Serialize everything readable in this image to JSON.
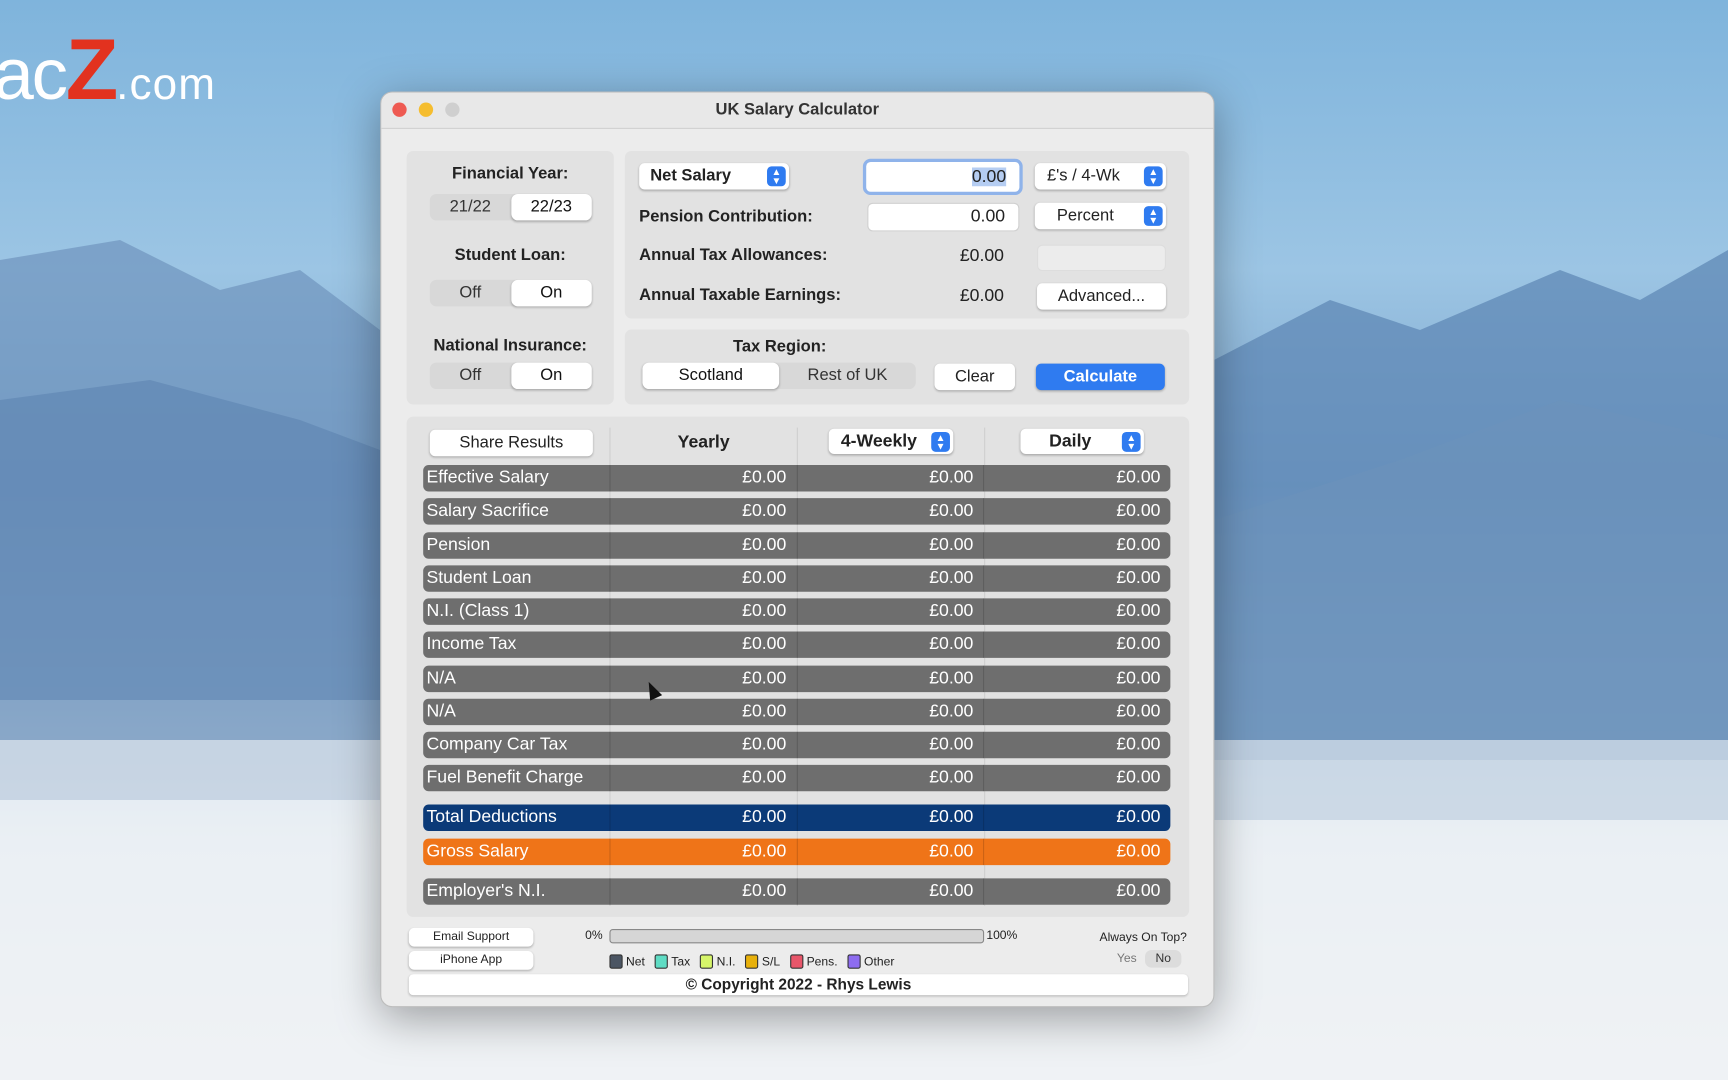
{
  "watermark": "macZ.com",
  "window": {
    "title": "UK Salary Calculator"
  },
  "left": {
    "financial_year_label": "Financial Year:",
    "years": [
      "21/22",
      "22/23"
    ],
    "year_selected": "22/23",
    "student_loan_label": "Student Loan:",
    "student_loan_options": [
      "Off",
      "On"
    ],
    "student_loan_selected": "On",
    "ni_label": "National Insurance:",
    "ni_options": [
      "Off",
      "On"
    ],
    "ni_selected": "On"
  },
  "inputs": {
    "salary_type": "Net Salary",
    "salary_value": "0.00",
    "salary_period": "£'s / 4-Wk",
    "pension_label": "Pension Contribution:",
    "pension_value": "0.00",
    "pension_unit": "Percent",
    "allowances_label": "Annual Tax Allowances:",
    "allowances_value": "£0.00",
    "taxable_label": "Annual Taxable Earnings:",
    "taxable_value": "£0.00",
    "advanced_label": "Advanced..."
  },
  "tax_region": {
    "label": "Tax Region:",
    "options": [
      "Scotland",
      "Rest of UK"
    ],
    "selected": "Scotland",
    "clear_label": "Clear",
    "calculate_label": "Calculate"
  },
  "results": {
    "share_label": "Share Results",
    "columns": [
      "Yearly",
      "4-Weekly",
      "Daily"
    ],
    "rows": [
      {
        "label": "Effective Salary",
        "values": [
          "£0.00",
          "£0.00",
          "£0.00"
        ]
      },
      {
        "label": "Salary Sacrifice",
        "values": [
          "£0.00",
          "£0.00",
          "£0.00"
        ]
      },
      {
        "label": "Pension",
        "values": [
          "£0.00",
          "£0.00",
          "£0.00"
        ]
      },
      {
        "label": "Student Loan",
        "values": [
          "£0.00",
          "£0.00",
          "£0.00"
        ]
      },
      {
        "label": "N.I. (Class 1)",
        "values": [
          "£0.00",
          "£0.00",
          "£0.00"
        ]
      },
      {
        "label": "Income Tax",
        "values": [
          "£0.00",
          "£0.00",
          "£0.00"
        ]
      },
      {
        "label": "N/A",
        "values": [
          "£0.00",
          "£0.00",
          "£0.00"
        ]
      },
      {
        "label": "N/A",
        "values": [
          "£0.00",
          "£0.00",
          "£0.00"
        ]
      },
      {
        "label": "Company Car Tax",
        "values": [
          "£0.00",
          "£0.00",
          "£0.00"
        ]
      },
      {
        "label": "Fuel Benefit Charge",
        "values": [
          "£0.00",
          "£0.00",
          "£0.00"
        ]
      }
    ],
    "total": {
      "label": "Total Deductions",
      "values": [
        "£0.00",
        "£0.00",
        "£0.00"
      ]
    },
    "gross": {
      "label": "Gross Salary",
      "values": [
        "£0.00",
        "£0.00",
        "£0.00"
      ]
    },
    "employer": {
      "label": "Employer's N.I.",
      "values": [
        "£0.00",
        "£0.00",
        "£0.00"
      ]
    }
  },
  "footer": {
    "email_label": "Email Support",
    "iphone_label": "iPhone App",
    "progress_min": "0%",
    "progress_max": "100%",
    "progress_value": 0,
    "legend": [
      {
        "label": "Net",
        "color": "#4b5563"
      },
      {
        "label": "Tax",
        "color": "#5fdcc4"
      },
      {
        "label": "N.I.",
        "color": "#d6f56a"
      },
      {
        "label": "S/L",
        "color": "#e8b10c"
      },
      {
        "label": "Pens.",
        "color": "#e8566a"
      },
      {
        "label": "Other",
        "color": "#8d6cf0"
      }
    ],
    "always_on_top_label": "Always On Top?",
    "always_on_top_options": [
      "Yes",
      "No"
    ],
    "always_on_top_selected": "No",
    "copyright": "© Copyright 2022 - Rhys Lewis"
  },
  "colors": {
    "accent": "#2f7bf0",
    "row": "#6e6e6e",
    "total": "#0b3a78",
    "gross": "#ef7418"
  }
}
